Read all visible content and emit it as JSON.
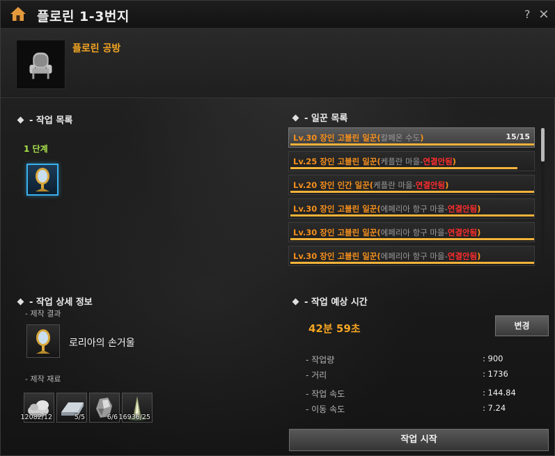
{
  "window": {
    "title": "플로린 1-3번지",
    "help_label": "?",
    "close_label": "×"
  },
  "workshop": {
    "name": "플로린 공방",
    "icon": "armchair-icon"
  },
  "work_list": {
    "title": "- 작업 목록",
    "stage_label": "1 단계",
    "recipe_icon": "hand-mirror-icon"
  },
  "worker_list": {
    "title": "- 일꾼 목록",
    "workers": [
      {
        "level": "Lv.30",
        "name": "장인 고블린 일꾼",
        "location": "칼페온 수도",
        "status": "",
        "count": "15/15",
        "stamina": 1.0,
        "selected": true
      },
      {
        "level": "Lv.25",
        "name": "장인 고블린 일꾼",
        "location": "케플란 마을-",
        "status": "연결안됨",
        "count": "",
        "stamina": 0.93,
        "selected": false
      },
      {
        "level": "Lv.20",
        "name": "장인 인간 일꾼",
        "location": "케플란 마을-",
        "status": "연결안됨",
        "count": "",
        "stamina": 1.0,
        "selected": false
      },
      {
        "level": "Lv.30",
        "name": "장인 고블린 일꾼",
        "location": "에페리아 항구 마을-",
        "status": "연결안됨",
        "count": "",
        "stamina": 1.0,
        "selected": false
      },
      {
        "level": "Lv.30",
        "name": "장인 고블린 일꾼",
        "location": "에페리아 항구 마을-",
        "status": "연결안됨",
        "count": "",
        "stamina": 1.0,
        "selected": false
      },
      {
        "level": "Lv.30",
        "name": "장인 고블린 일꾼",
        "location": "에페리아 항구 마을-",
        "status": "연결안됨",
        "count": "",
        "stamina": 1.0,
        "selected": false
      }
    ]
  },
  "details": {
    "title": "- 작업 상세 정보",
    "result_label": "- 제작 결과",
    "result_name": "로리아의 손거울",
    "materials_label": "- 제작 재료",
    "materials": [
      {
        "icon": "ore-pile-icon",
        "count": "12082/12"
      },
      {
        "icon": "ingot-icon",
        "count": "5/5"
      },
      {
        "icon": "crystal-icon",
        "count": "6/6"
      },
      {
        "icon": "light-essence-icon",
        "count": "16936/25"
      }
    ]
  },
  "estimate": {
    "title": "- 작업 예상 시간",
    "time": "42분 59초",
    "change_label": "변경",
    "stats": [
      {
        "label": "- 작업량",
        "value": ": 900"
      },
      {
        "label": "- 거리",
        "value": ": 1736"
      },
      {
        "label": "- 작업 속도",
        "value": ": 144.84"
      },
      {
        "label": "- 이동 속도",
        "value": ": 7.24"
      }
    ]
  },
  "start_label": "작업 시작",
  "colors": {
    "accent_orange": "#f4a522",
    "warning_red": "#ff2c2c",
    "stage_green": "#a8e04a",
    "stamina_bar": "#f3b33a"
  }
}
